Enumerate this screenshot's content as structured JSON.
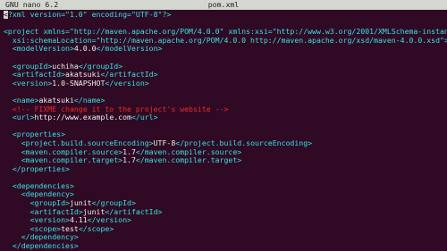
{
  "title_bar": {
    "app": "GNU nano 6.2",
    "filename": "pom.xml"
  },
  "colors": {
    "background": "#300a24",
    "title_bar": "#d3d7cf",
    "tag": "#34e2e2",
    "text": "#eeeeec",
    "comment": "#ef2929"
  },
  "lines": [
    [
      {
        "c": "cursor",
        "t": "<"
      },
      {
        "c": "decl",
        "t": "?xml version=\"1.0\" encoding=\"UTF-8\"?>"
      }
    ],
    [],
    [
      {
        "c": "tag",
        "t": "<project xmlns=\"http://maven.apache.org/POM/4.0.0\" xmlns:xsi=\"http://www.w3.org/2001/XMLSchema-instance\""
      }
    ],
    [
      {
        "c": "tag",
        "t": "  xsi:schemaLocation=\"http://maven.apache.org/POM/4.0.0 http://maven.apache.org/xsd/maven-4.0.0.xsd\">"
      }
    ],
    [
      {
        "c": "tag",
        "t": "  <modelVersion>"
      },
      {
        "c": "txt",
        "t": "4.0.0"
      },
      {
        "c": "tag",
        "t": "</modelVersion>"
      }
    ],
    [],
    [
      {
        "c": "tag",
        "t": "  <groupId>"
      },
      {
        "c": "txt",
        "t": "uchiha"
      },
      {
        "c": "tag",
        "t": "</groupId>"
      }
    ],
    [
      {
        "c": "tag",
        "t": "  <artifactId>"
      },
      {
        "c": "txt",
        "t": "akatsuki"
      },
      {
        "c": "tag",
        "t": "</artifactId>"
      }
    ],
    [
      {
        "c": "tag",
        "t": "  <version>"
      },
      {
        "c": "txt",
        "t": "1.0-SNAPSHOT"
      },
      {
        "c": "tag",
        "t": "</version>"
      }
    ],
    [],
    [
      {
        "c": "tag",
        "t": "  <name>"
      },
      {
        "c": "txt",
        "t": "akatsuki"
      },
      {
        "c": "tag",
        "t": "</name>"
      }
    ],
    [
      {
        "c": "cmt",
        "t": "  <!-- FIXME change it to the project's website -->"
      }
    ],
    [
      {
        "c": "tag",
        "t": "  <url>"
      },
      {
        "c": "txt",
        "t": "http://www.example.com"
      },
      {
        "c": "tag",
        "t": "</url>"
      }
    ],
    [],
    [
      {
        "c": "tag",
        "t": "  <properties>"
      }
    ],
    [
      {
        "c": "tag",
        "t": "    <project.build.sourceEncoding>"
      },
      {
        "c": "txt",
        "t": "UTF-8"
      },
      {
        "c": "tag",
        "t": "</project.build.sourceEncoding>"
      }
    ],
    [
      {
        "c": "tag",
        "t": "    <maven.compiler.source>"
      },
      {
        "c": "txt",
        "t": "1.7"
      },
      {
        "c": "tag",
        "t": "</maven.compiler.source>"
      }
    ],
    [
      {
        "c": "tag",
        "t": "    <maven.compiler.target>"
      },
      {
        "c": "txt",
        "t": "1.7"
      },
      {
        "c": "tag",
        "t": "</maven.compiler.target>"
      }
    ],
    [
      {
        "c": "tag",
        "t": "  </properties>"
      }
    ],
    [],
    [
      {
        "c": "tag",
        "t": "  <dependencies>"
      }
    ],
    [
      {
        "c": "tag",
        "t": "    <dependency>"
      }
    ],
    [
      {
        "c": "tag",
        "t": "      <groupId>"
      },
      {
        "c": "txt",
        "t": "junit"
      },
      {
        "c": "tag",
        "t": "</groupId>"
      }
    ],
    [
      {
        "c": "tag",
        "t": "      <artifactId>"
      },
      {
        "c": "txt",
        "t": "junit"
      },
      {
        "c": "tag",
        "t": "</artifactId>"
      }
    ],
    [
      {
        "c": "tag",
        "t": "      <version>"
      },
      {
        "c": "txt",
        "t": "4.11"
      },
      {
        "c": "tag",
        "t": "</version>"
      }
    ],
    [
      {
        "c": "tag",
        "t": "      <scope>"
      },
      {
        "c": "txt",
        "t": "test"
      },
      {
        "c": "tag",
        "t": "</scope>"
      }
    ],
    [
      {
        "c": "tag",
        "t": "    </dependency>"
      }
    ],
    [
      {
        "c": "tag",
        "t": "  </dependencies>"
      }
    ]
  ]
}
